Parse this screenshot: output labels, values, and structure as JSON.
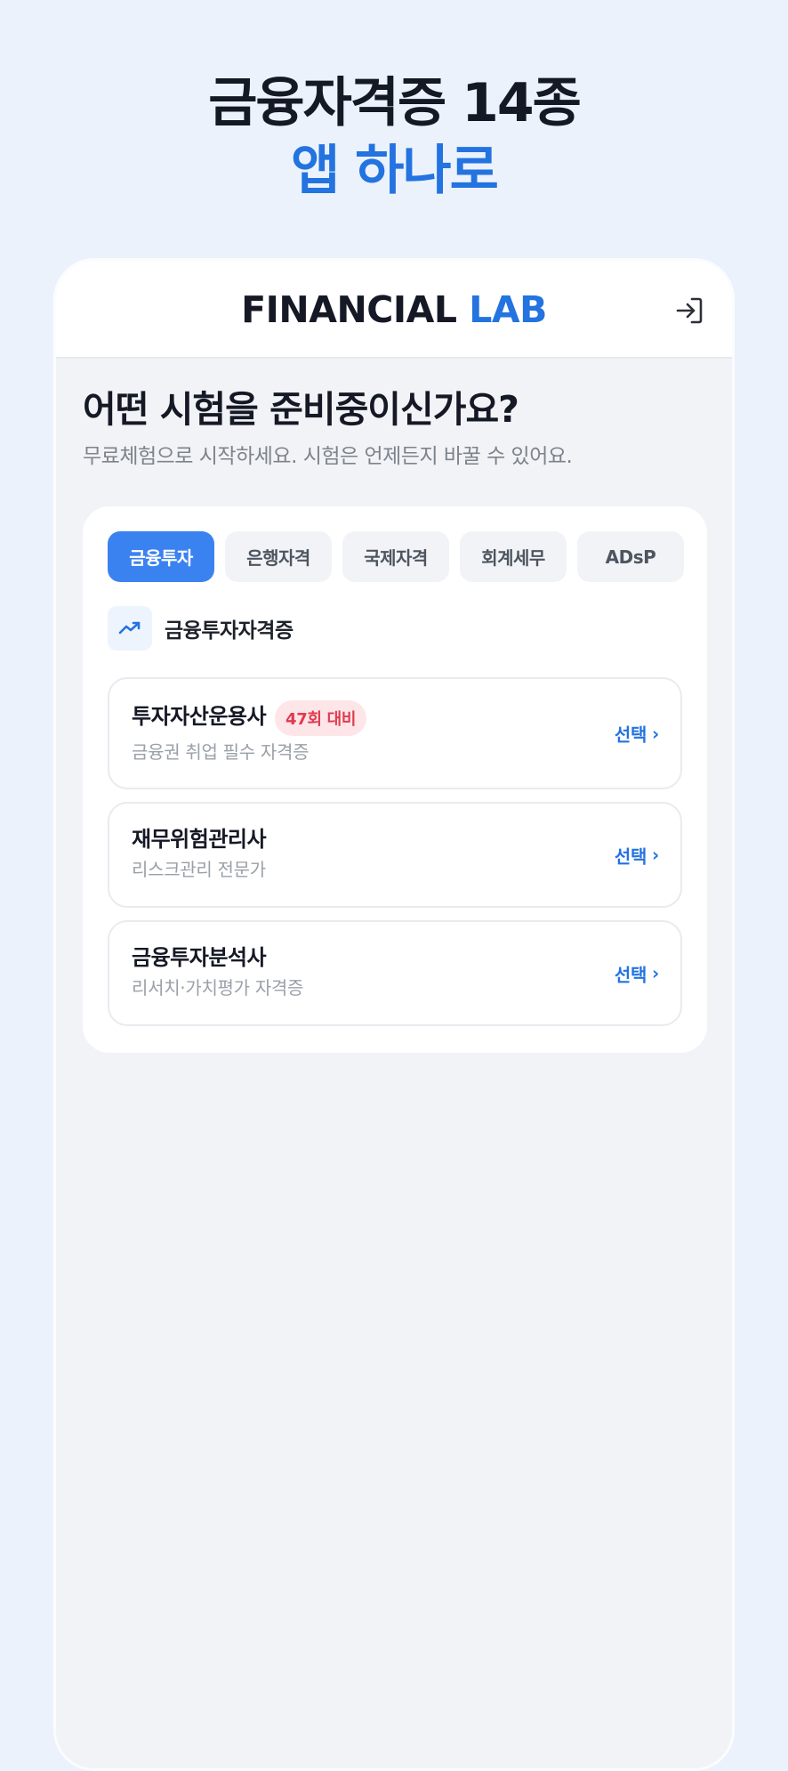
{
  "promo": {
    "line1": "금융자격증 14종",
    "line2": "앱 하나로"
  },
  "appbar": {
    "brand_part1": "FINANCIAL",
    "brand_part2": "LAB",
    "login_icon": "login-icon"
  },
  "main": {
    "heading": "어떤 시험을 준비중이신가요?",
    "subheading": "무료체험으로 시작하세요. 시험은 언제든지 바꿀 수 있어요."
  },
  "tabs": [
    {
      "label": "금융투자",
      "active": true
    },
    {
      "label": "은행자격",
      "active": false
    },
    {
      "label": "국제자격",
      "active": false
    },
    {
      "label": "회계세무",
      "active": false
    },
    {
      "label": "ADsP",
      "active": false
    }
  ],
  "section": {
    "icon": "trending-up-icon",
    "title": "금융투자자격증"
  },
  "exams": [
    {
      "name": "투자자산운용사",
      "badge": "47회 대비",
      "desc": "금융권 취업 필수 자격증",
      "select": "선택",
      "chevron": "›"
    },
    {
      "name": "재무위험관리사",
      "desc": "리스크관리 전문가",
      "select": "선택",
      "chevron": "›"
    },
    {
      "name": "금융투자분석사",
      "desc": "리서치·가치평가 자격증",
      "select": "선택",
      "chevron": "›"
    }
  ],
  "colors": {
    "accent": "#2373e0",
    "tab_active": "#3b82f1",
    "badge_bg": "#fde5e8",
    "badge_text": "#e03b4f",
    "background": "#ebf2fb"
  }
}
